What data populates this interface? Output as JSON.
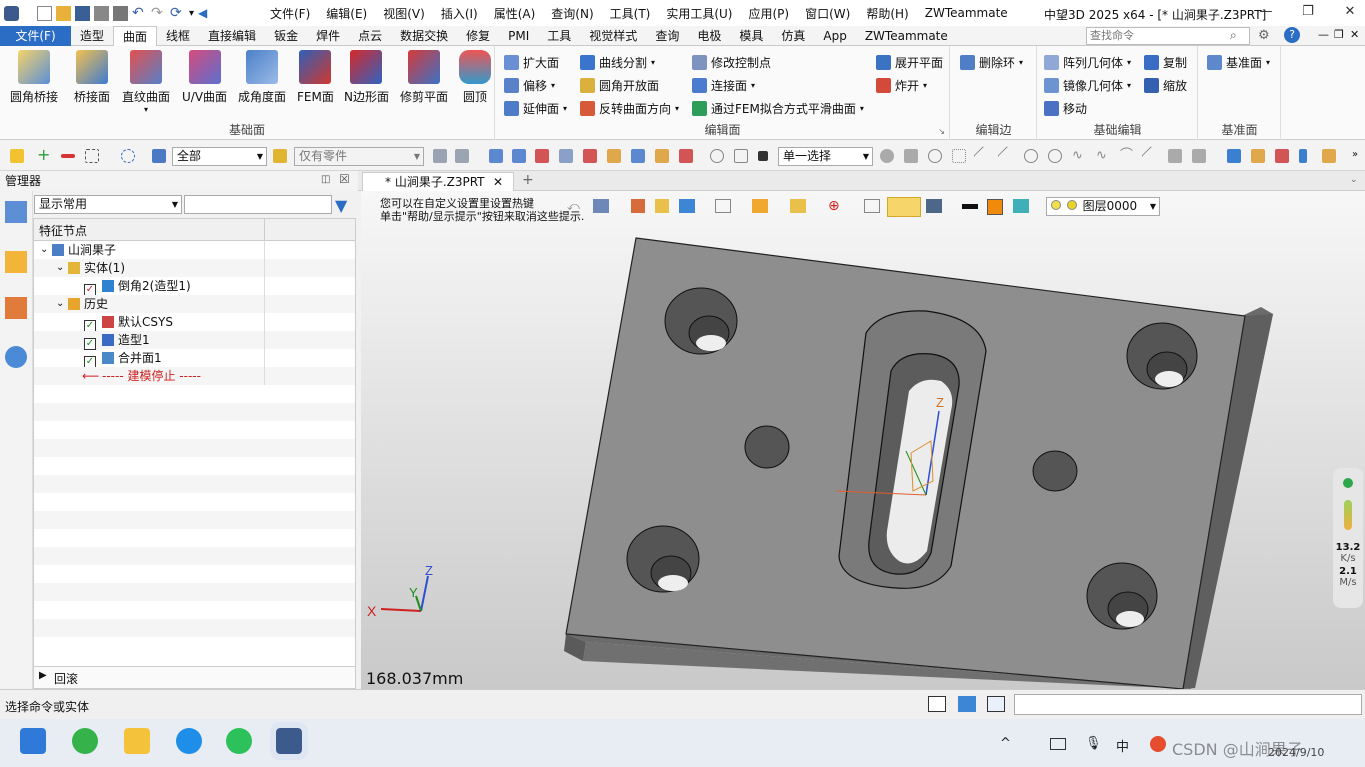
{
  "quick_access": {
    "dropdown": "▾"
  },
  "menu": [
    "文件(F)",
    "编辑(E)",
    "视图(V)",
    "插入(I)",
    "属性(A)",
    "查询(N)",
    "工具(T)",
    "实用工具(U)",
    "应用(P)",
    "窗口(W)",
    "帮助(H)",
    "ZWTeammate"
  ],
  "app_title": "中望3D 2025 x64 - [* 山涧果子.Z3PRT]",
  "window_buttons": {
    "min": "—",
    "restore": "❐",
    "close": "✕",
    "doc_min": "—",
    "doc_restore": "❐",
    "doc_close": "✕"
  },
  "tabs": [
    "文件(F)",
    "造型",
    "曲面",
    "线框",
    "直接编辑",
    "钣金",
    "焊件",
    "点云",
    "数据交换",
    "修复",
    "PMI",
    "工具",
    "视觉样式",
    "查询",
    "电极",
    "模具",
    "仿真",
    "App",
    "ZWTeammate"
  ],
  "active_tab": "曲面",
  "search": {
    "placeholder": "查找命令"
  },
  "ribbon": {
    "base_surface": {
      "label": "基础面",
      "buttons": [
        "圆角桥接",
        "桥接面",
        "直纹曲面",
        "U/V曲面",
        "成角度面",
        "FEM面",
        "N边形面",
        "修剪平面",
        "圆顶"
      ]
    },
    "edit_surface": {
      "label": "编辑面",
      "col1": [
        "扩大面",
        "偏移",
        "延伸面"
      ],
      "col2": [
        "曲线分割",
        "圆角开放面",
        "反转曲面方向"
      ],
      "col3": [
        "修改控制点",
        "连接面",
        "通过FEM拟合方式平滑曲面"
      ],
      "col4": [
        "展开平面",
        "炸开"
      ]
    },
    "edit_edge": {
      "label": "编辑边",
      "buttons": [
        "删除环"
      ]
    },
    "basic_edit": {
      "label": "基础编辑",
      "col1": [
        "阵列几何体",
        "镜像几何体",
        "移动"
      ],
      "col2": [
        "复制",
        "缩放"
      ]
    },
    "datum": {
      "label": "基准面",
      "buttons": [
        "基准面"
      ]
    }
  },
  "toolbar2": {
    "filter": "全部",
    "part_filter": "仅有零件",
    "select_mode": "单一选择"
  },
  "manager": {
    "title": "管理器",
    "display_combo": "显示常用",
    "column_header": "特征节点",
    "tree": [
      {
        "label": "山涧果子",
        "level": 0,
        "expand": "⌄",
        "check": false
      },
      {
        "label": "实体(1)",
        "level": 1,
        "expand": "⌄",
        "check": false
      },
      {
        "label": "倒角2(造型1)",
        "level": 2,
        "expand": "",
        "check": true,
        "check_color": "#d02020"
      },
      {
        "label": "历史",
        "level": 1,
        "expand": "⌄",
        "check": false
      },
      {
        "label": "默认CSYS",
        "level": 2,
        "expand": "",
        "check": true,
        "check_color": "#1a8f1a"
      },
      {
        "label": "造型1",
        "level": 2,
        "expand": "",
        "check": true,
        "check_color": "#1a8f1a"
      },
      {
        "label": "合并面1",
        "level": 2,
        "expand": "",
        "check": true,
        "check_color": "#1a8f1a"
      },
      {
        "label": "----- 建模停止 -----",
        "level": 2,
        "expand": "",
        "check": false,
        "stop": true
      }
    ],
    "footer": "回滚"
  },
  "document": {
    "tab_title": "* 山涧果子.Z3PRT",
    "add_tab": "+",
    "tip_line1": "您可以在自定义设置里设置热键",
    "tip_line2": "单击\"帮助/显示提示\"按钮来取消这些提示.",
    "layer": "图层0000",
    "dimension": "168.037mm",
    "axes": {
      "x": "X",
      "y": "Y",
      "z": "Z"
    }
  },
  "perf": {
    "top_value": "13.2",
    "top_unit": "K/s",
    "bottom_value": "2.1",
    "bottom_unit": "M/s"
  },
  "status": {
    "prompt": "选择命令或实体"
  },
  "taskbar": {
    "chevron": "^",
    "ime": "中",
    "watermark": "CSDN @山涧果子",
    "date": "2024/9/10"
  },
  "colors": {
    "accent": "#2b6cc4",
    "part_face": "#8a8a8a",
    "part_top": "#969696"
  }
}
